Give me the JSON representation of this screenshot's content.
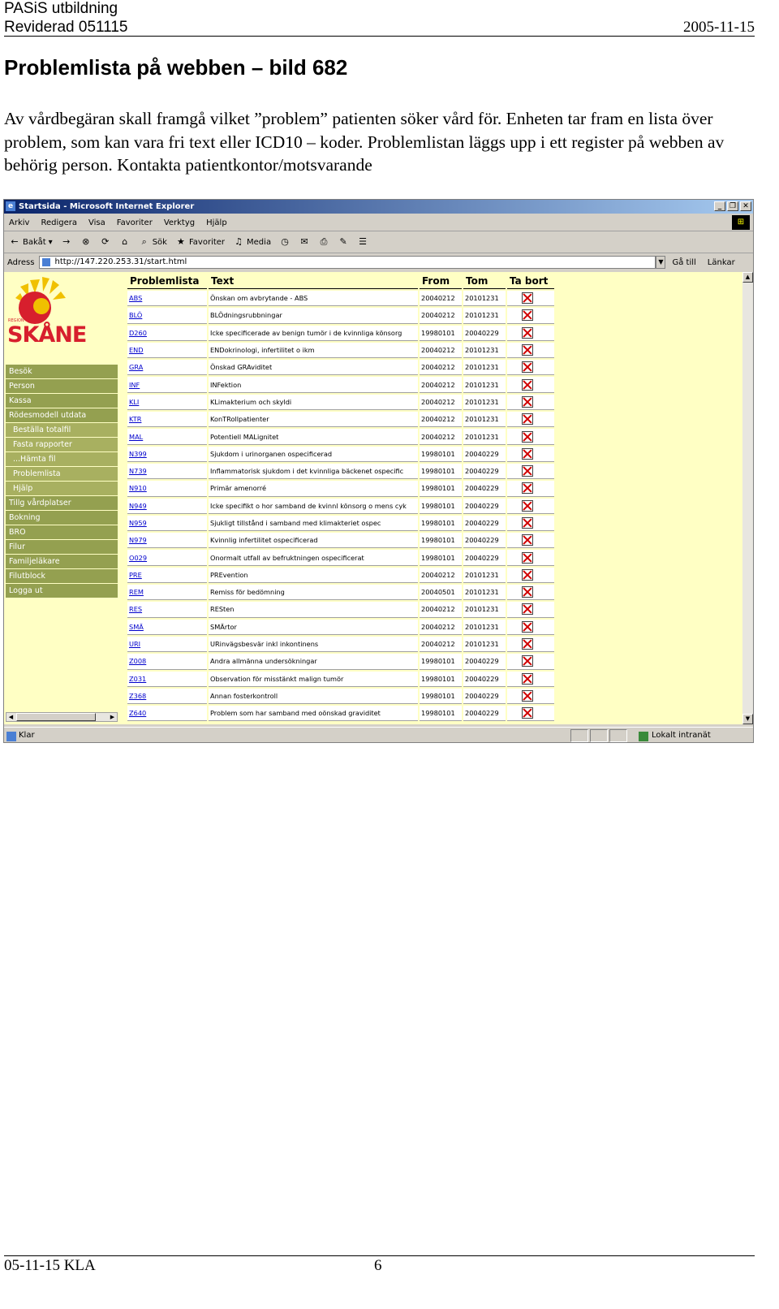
{
  "header": {
    "line1": "PASiS utbildning",
    "line2": "Reviderad 051115",
    "date": "2005-11-15"
  },
  "title": "Problemlista på webben – bild 682",
  "paragraph": "Av vårdbegäran skall framgå vilket ”problem” patienten söker vård för. Enheten tar fram en lista över problem, som kan vara fri text eller ICD10 – koder. Problemlistan läggs upp i ett register på webben av behörig person. Kontakta patientkontor/motsvarande",
  "browser": {
    "window_title": "Startsida - Microsoft Internet Explorer",
    "menu": [
      "Arkiv",
      "Redigera",
      "Visa",
      "Favoriter",
      "Verktyg",
      "Hjälp"
    ],
    "toolbar": {
      "back": "Bakåt",
      "search": "Sök",
      "favorites": "Favoriter",
      "media": "Media"
    },
    "address_label": "Adress",
    "address_value": "http://147.220.253.31/start.html",
    "go_label": "Gå till",
    "links_label": "Länkar",
    "status_text": "Klar",
    "status_zone": "Lokalt intranät"
  },
  "logo": {
    "small": "REGION",
    "text": "SKÅNE",
    "colors": {
      "red": "#d71f2d",
      "yellow": "#f0c000"
    }
  },
  "nav": [
    {
      "label": "Besök",
      "sub": false
    },
    {
      "label": "Person",
      "sub": false
    },
    {
      "label": "Kassa",
      "sub": false
    },
    {
      "label": "Rödesmodell utdata",
      "sub": false
    },
    {
      "label": "Beställa totalfil",
      "sub": true
    },
    {
      "label": "Fasta rapporter",
      "sub": true
    },
    {
      "label": "...Hämta fil",
      "sub": true
    },
    {
      "label": "Problemlista",
      "sub": true
    },
    {
      "label": "Hjälp",
      "sub": true
    },
    {
      "label": "Tillg vårdplatser",
      "sub": false
    },
    {
      "label": "Bokning",
      "sub": false
    },
    {
      "label": "BRO",
      "sub": false
    },
    {
      "label": "Filur",
      "sub": false
    },
    {
      "label": "Familjeläkare",
      "sub": false
    },
    {
      "label": "Filutblock",
      "sub": false
    },
    {
      "label": "Logga ut",
      "sub": false
    }
  ],
  "table": {
    "headers": [
      "Problemlista",
      "Text",
      "From",
      "Tom",
      "Ta bort"
    ],
    "rows": [
      {
        "code": "ABS",
        "text": "Önskan om avbrytande - ABS",
        "from": "20040212",
        "tom": "20101231"
      },
      {
        "code": "BLÖ",
        "text": "BLÖdningsrubbningar",
        "from": "20040212",
        "tom": "20101231"
      },
      {
        "code": "D260",
        "text": "Icke specificerade av benign tumör i de kvinnliga könsorg",
        "from": "19980101",
        "tom": "20040229"
      },
      {
        "code": "END",
        "text": "ENDokrinologi, infertilitet o ikm",
        "from": "20040212",
        "tom": "20101231"
      },
      {
        "code": "GRA",
        "text": "Önskad GRAviditet",
        "from": "20040212",
        "tom": "20101231"
      },
      {
        "code": "INF",
        "text": "INFektion",
        "from": "20040212",
        "tom": "20101231"
      },
      {
        "code": "KLI",
        "text": "KLimakterium och skyldi",
        "from": "20040212",
        "tom": "20101231"
      },
      {
        "code": "KTR",
        "text": "KonTRollpatienter",
        "from": "20040212",
        "tom": "20101231"
      },
      {
        "code": "MAL",
        "text": "Potentiell MALignitet",
        "from": "20040212",
        "tom": "20101231"
      },
      {
        "code": "N399",
        "text": "Sjukdom i urinorganen ospecificerad",
        "from": "19980101",
        "tom": "20040229"
      },
      {
        "code": "N739",
        "text": "Inflammatorisk sjukdom i det kvinnliga bäckenet ospecific",
        "from": "19980101",
        "tom": "20040229"
      },
      {
        "code": "N910",
        "text": "Primär amenorré",
        "from": "19980101",
        "tom": "20040229"
      },
      {
        "code": "N949",
        "text": "Icke specifikt o hor samband de kvinnl könsorg o mens cyk",
        "from": "19980101",
        "tom": "20040229"
      },
      {
        "code": "N959",
        "text": "Sjukligt tillstånd i samband med klimakteriet ospec",
        "from": "19980101",
        "tom": "20040229"
      },
      {
        "code": "N979",
        "text": "Kvinnlig infertilitet ospecificerad",
        "from": "19980101",
        "tom": "20040229"
      },
      {
        "code": "O029",
        "text": "Onormalt utfall av befruktningen ospecificerat",
        "from": "19980101",
        "tom": "20040229"
      },
      {
        "code": "PRE",
        "text": "PREvention",
        "from": "20040212",
        "tom": "20101231"
      },
      {
        "code": "REM",
        "text": "Remiss för bedömning",
        "from": "20040501",
        "tom": "20101231"
      },
      {
        "code": "RES",
        "text": "RESten",
        "from": "20040212",
        "tom": "20101231"
      },
      {
        "code": "SMÄ",
        "text": "SMÄrtor",
        "from": "20040212",
        "tom": "20101231"
      },
      {
        "code": "URI",
        "text": "URinvägsbesvär inkl inkontinens",
        "from": "20040212",
        "tom": "20101231"
      },
      {
        "code": "Z008",
        "text": "Andra allmänna undersökningar",
        "from": "19980101",
        "tom": "20040229"
      },
      {
        "code": "Z031",
        "text": "Observation för misstänkt malign tumör",
        "from": "19980101",
        "tom": "20040229"
      },
      {
        "code": "Z368",
        "text": "Annan fosterkontroll",
        "from": "19980101",
        "tom": "20040229"
      },
      {
        "code": "Z640",
        "text": "Problem som har samband med oönskad graviditet",
        "from": "19980101",
        "tom": "20040229"
      }
    ]
  },
  "footer": {
    "left": "05-11-15 KLA",
    "page": "6"
  }
}
